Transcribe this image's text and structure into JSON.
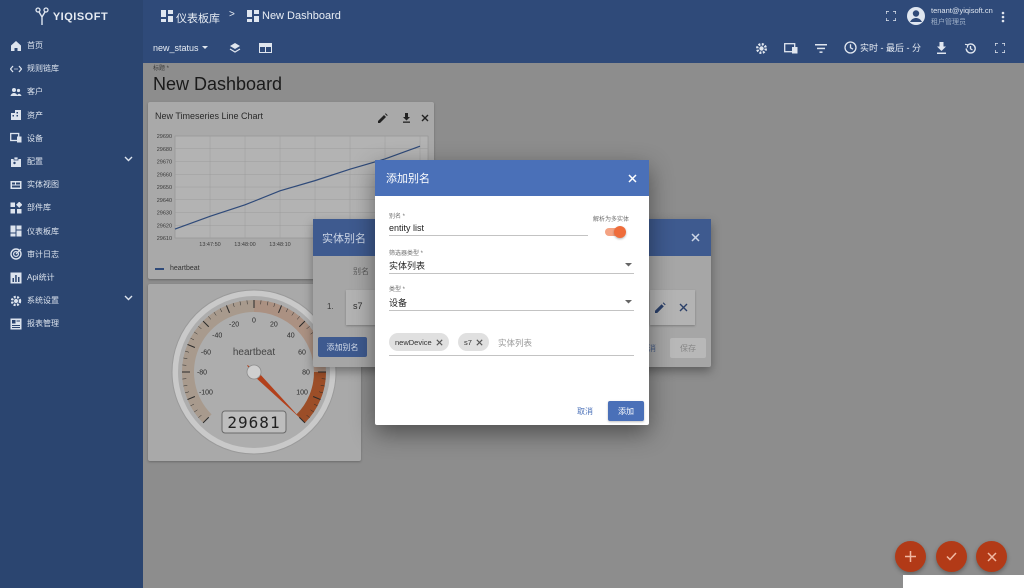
{
  "app": {
    "logo_text": "YIQISOFT"
  },
  "sidebar": {
    "items": [
      {
        "label": "首页",
        "icon": "home-icon"
      },
      {
        "label": "规则链库",
        "icon": "rule-chain-icon"
      },
      {
        "label": "客户",
        "icon": "customers-icon"
      },
      {
        "label": "资产",
        "icon": "assets-icon"
      },
      {
        "label": "设备",
        "icon": "devices-icon"
      },
      {
        "label": "配置",
        "icon": "profiles-icon",
        "expandable": true
      },
      {
        "label": "实体视图",
        "icon": "entity-view-icon"
      },
      {
        "label": "部件库",
        "icon": "widgets-icon"
      },
      {
        "label": "仪表板库",
        "icon": "dashboards-icon"
      },
      {
        "label": "审计日志",
        "icon": "audit-log-icon"
      },
      {
        "label": "Api统计",
        "icon": "api-stats-icon"
      },
      {
        "label": "系统设置",
        "icon": "settings-icon",
        "expandable": true
      },
      {
        "label": "报表管理",
        "icon": "reports-icon"
      }
    ]
  },
  "topbar": {
    "breadcrumb_parent": "仪表板库",
    "breadcrumb_sep": ">",
    "breadcrumb_current": "New Dashboard",
    "user_email": "tenant@yiqisoft.cn",
    "user_role": "租户管理员"
  },
  "toolbar": {
    "state_label": "new_status",
    "time_window": "实时 - 最后 - 分"
  },
  "dashboard": {
    "title_label": "标题 *",
    "title": "New Dashboard"
  },
  "chart_widget": {
    "title": "New Timeseries Line Chart",
    "legend": "heartbeat",
    "chart_data": {
      "type": "line",
      "x": [
        "13:47:40",
        "13:47:50",
        "13:48:00",
        "13:48:10",
        "13:48:20",
        "13:48:30",
        "13:48:40",
        "13:48:50"
      ],
      "series": [
        {
          "name": "heartbeat",
          "values": [
            29617,
            29627,
            29636,
            29647,
            29655,
            29664,
            29672,
            29682
          ]
        }
      ],
      "y_ticks": [
        29610,
        29620,
        29630,
        29640,
        29650,
        29660,
        29670,
        29680,
        29690
      ],
      "x_ticks": [
        "13:47:50",
        "13:48:00",
        "13:48:10"
      ],
      "ylim": [
        29610,
        29690
      ]
    }
  },
  "gauge_widget": {
    "title": "heartbeat",
    "value": "29681",
    "gauge_value": 29681,
    "gauge_min": -120,
    "gauge_max": 120,
    "tick_labels": [
      "-100",
      "-80",
      "-60",
      "-40",
      "-20",
      "0",
      "20",
      "40",
      "60",
      "80",
      "100"
    ]
  },
  "alias_dialog_bg": {
    "title": "实体别名",
    "column_alias": "别名",
    "row_index": "1.",
    "row_alias": "s7",
    "add_alias_btn": "添加别名",
    "cancel_partial": "消",
    "save_btn": "保存"
  },
  "add_alias_dialog": {
    "title": "添加别名",
    "alias_label": "别名 *",
    "alias_value": "entity list",
    "resolve_multiple_label": "解析为多实体",
    "resolve_multiple_on": true,
    "filter_type_label": "筛选器类型 *",
    "filter_type_value": "实体列表",
    "type_label": "类型 *",
    "type_value": "设备",
    "entities": [
      "newDevice",
      "s7"
    ],
    "entity_list_placeholder": "实体列表",
    "cancel_label": "取消",
    "add_label": "添加"
  },
  "fabs": [
    {
      "icon": "plus-icon"
    },
    {
      "icon": "check-icon"
    },
    {
      "icon": "close-icon"
    }
  ],
  "colors": {
    "sidebar": "#2b4570",
    "header": "#2f4a79",
    "dialog_header": "#4a70b8",
    "fab": "#b23a17",
    "toggle": "#ef6c3a"
  }
}
